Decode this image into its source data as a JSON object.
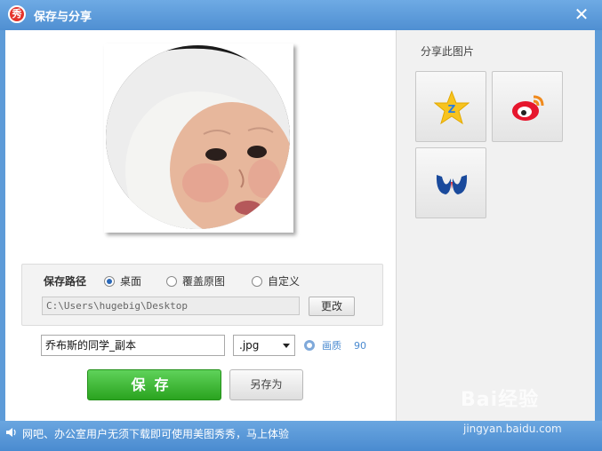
{
  "window": {
    "title": "保存与分享",
    "logo_char": "秀",
    "close_glyph": "✕"
  },
  "save_path": {
    "label": "保存路径",
    "options": [
      {
        "label": "桌面",
        "checked": true
      },
      {
        "label": "覆盖原图",
        "checked": false
      },
      {
        "label": "自定义",
        "checked": false
      }
    ],
    "path_value": "C:\\Users\\hugebig\\Desktop",
    "change_button": "更改"
  },
  "file": {
    "name_value": "乔布斯的同学_副本",
    "extension": ".jpg",
    "quality_label": "画质",
    "quality_value": "90"
  },
  "actions": {
    "save": "保存",
    "save_as": "另存为"
  },
  "share": {
    "title": "分享此图片",
    "targets": [
      "qzone-icon",
      "weibo-icon",
      "renren-icon"
    ]
  },
  "statusbar": {
    "text": "网吧、办公室用户无须下载即可使用美图秀秀，马上体验"
  },
  "watermark": {
    "brand": "Bai经验",
    "url": "jingyan.baidu.com"
  },
  "colors": {
    "title_bar": "#5d9bd8",
    "save_green": "#2aa31f",
    "link_blue": "#4a8ad0"
  }
}
